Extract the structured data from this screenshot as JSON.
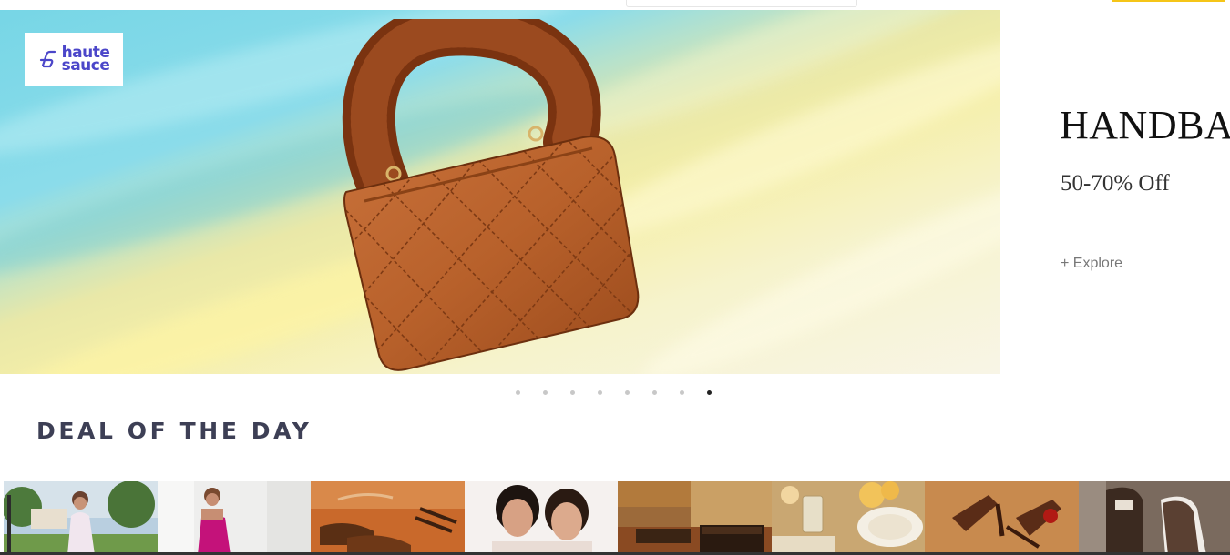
{
  "banner": {
    "brand_logo_text": "haute\nsauce",
    "title": "HANDBAGS",
    "discount": "50-70% Off",
    "cta": "+ Explore",
    "colors": {
      "brand": "#4b46c9",
      "bag": "#b8612b",
      "fur": "#8a3a12"
    }
  },
  "carousel": {
    "total_slides": 8,
    "active_slide": 8
  },
  "deals": {
    "title": "DEAL OF THE DAY",
    "tiles": [
      {
        "icon": "woman-garden-image"
      },
      {
        "icon": "pink-dress-image"
      },
      {
        "icon": "brown-shoes-image"
      },
      {
        "icon": "two-women-portrait-image"
      },
      {
        "icon": "leather-wallet-belt-image"
      },
      {
        "icon": "glassware-tableware-image"
      },
      {
        "icon": "heeled-sandals-image"
      },
      {
        "icon": "loafer-shoes-image"
      }
    ]
  }
}
